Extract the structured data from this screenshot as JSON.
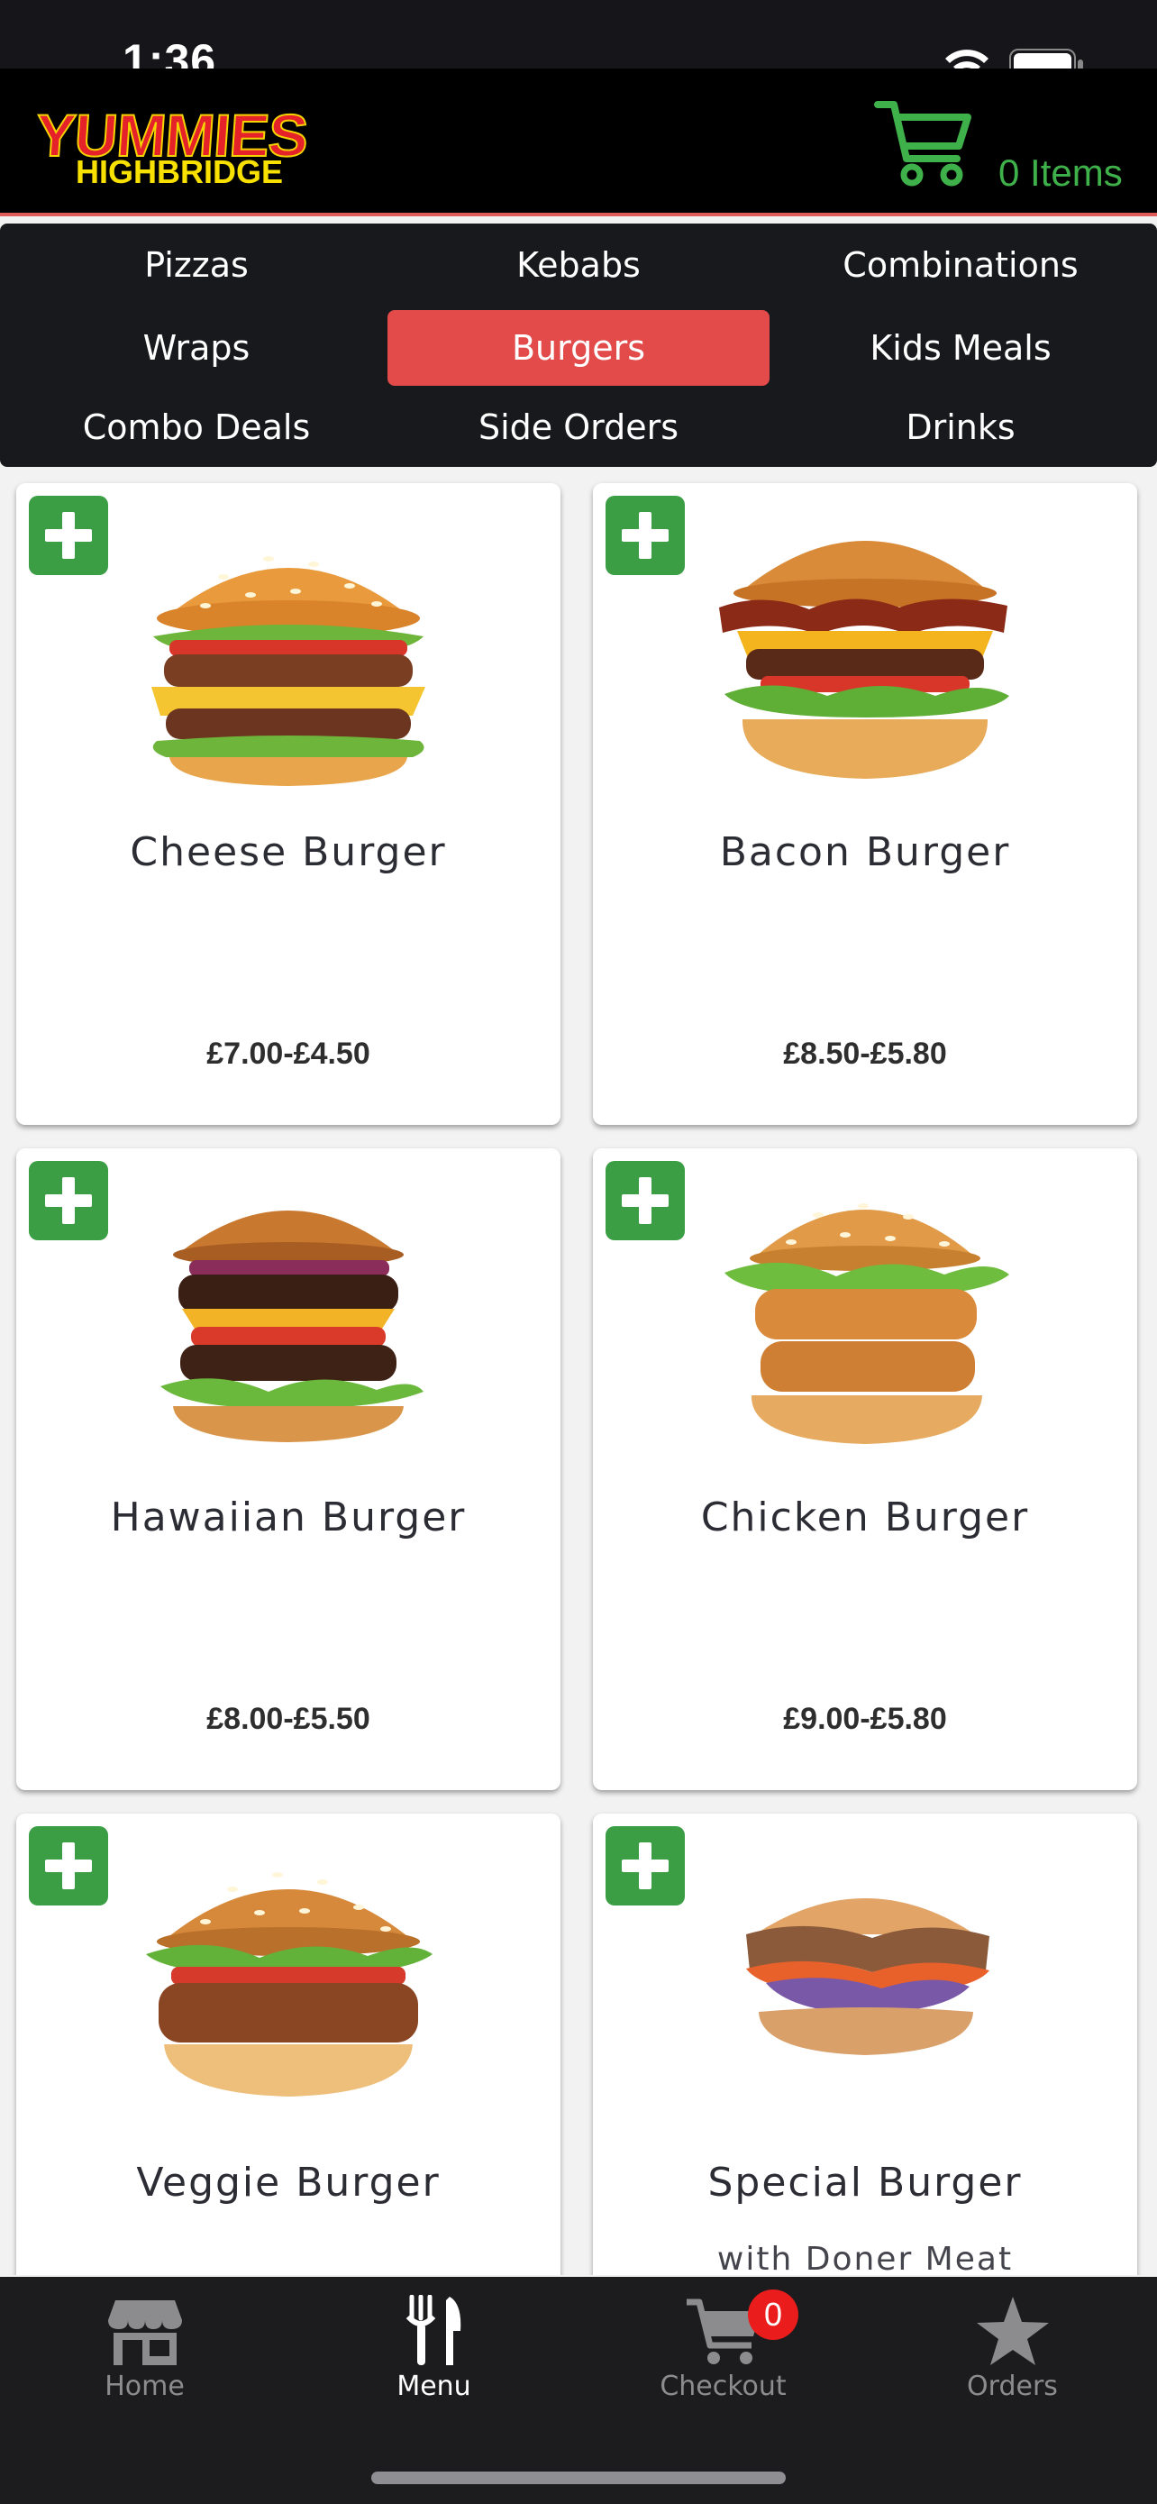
{
  "status_bar": {
    "time": "1:36"
  },
  "header": {
    "logo_top": "YUMMIES",
    "logo_bottom": "HIGHBRIDGE",
    "cart_count": "0 Items"
  },
  "categories": [
    {
      "label": "Pizzas",
      "active": false
    },
    {
      "label": "Kebabs",
      "active": false
    },
    {
      "label": "Combinations",
      "active": false
    },
    {
      "label": "Wraps",
      "active": false
    },
    {
      "label": "Burgers",
      "active": true
    },
    {
      "label": "Kids Meals",
      "active": false
    },
    {
      "label": "Combo Deals",
      "active": false
    },
    {
      "label": "Side Orders",
      "active": false
    },
    {
      "label": "Drinks",
      "active": false
    }
  ],
  "products": [
    {
      "name": "Cheese Burger",
      "desc": "",
      "price": "£7.00-£4.50",
      "image": "cheese-burger-image"
    },
    {
      "name": "Bacon Burger",
      "desc": "",
      "price": "£8.50-£5.80",
      "image": "bacon-burger-image"
    },
    {
      "name": "Hawaiian Burger",
      "desc": "",
      "price": "£8.00-£5.50",
      "image": "hawaiian-burger-image"
    },
    {
      "name": "Chicken Burger",
      "desc": "",
      "price": "£9.00-£5.80",
      "image": "chicken-burger-image"
    },
    {
      "name": "Veggie Burger",
      "desc": "",
      "price": "",
      "image": "veggie-burger-image"
    },
    {
      "name": "Special Burger",
      "desc": "with Doner Meat",
      "price": "",
      "image": "special-burger-image"
    }
  ],
  "tab_bar": {
    "tabs": [
      {
        "label": "Home",
        "icon": "store-icon",
        "active": false
      },
      {
        "label": "Menu",
        "icon": "fork-knife-icon",
        "active": true
      },
      {
        "label": "Checkout",
        "icon": "cart-icon",
        "active": false
      },
      {
        "label": "Orders",
        "icon": "star-icon",
        "active": false
      }
    ],
    "checkout_badge": "0"
  },
  "colors": {
    "accent_red": "#e34a4a",
    "add_green": "#3b9e45",
    "cart_green": "#3fb14a"
  }
}
